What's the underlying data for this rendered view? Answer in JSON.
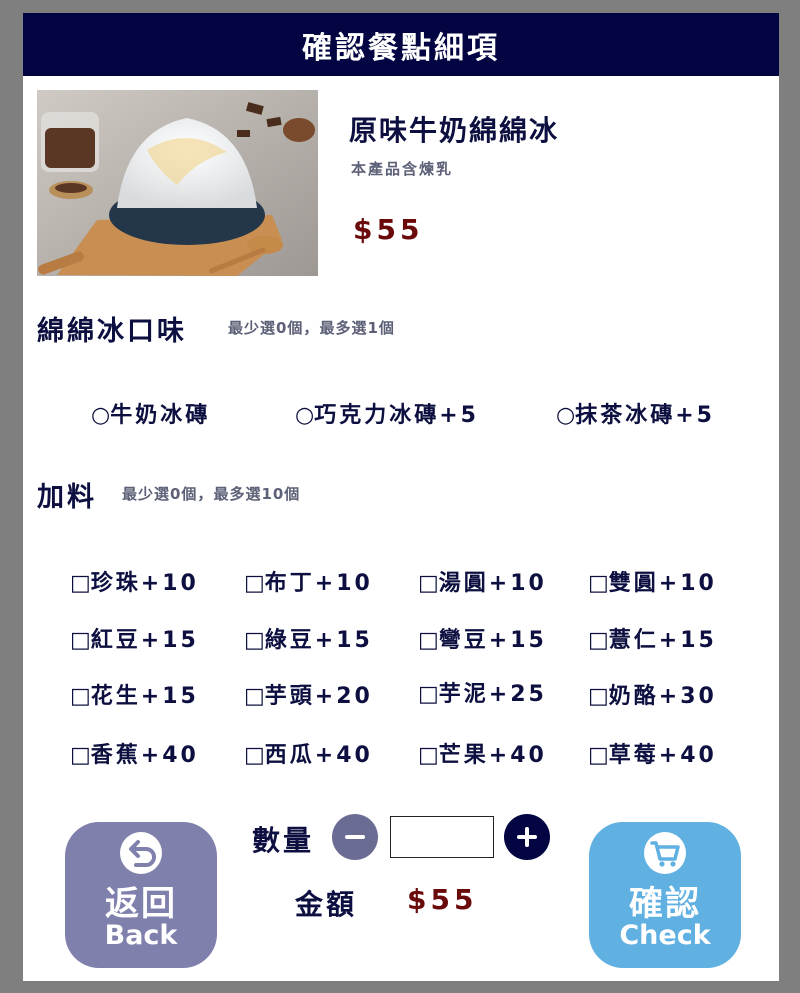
{
  "header": {
    "title": "確認餐點細項"
  },
  "product": {
    "image_alt": "原味牛奶綿綿冰",
    "name": "原味牛奶綿綿冰",
    "note": "本產品含煉乳",
    "price": "$55"
  },
  "flavor_section": {
    "title": "綿綿冰口味",
    "hint": "最少選0個，最多選1個",
    "options": [
      {
        "mark": "○",
        "label": "牛奶冰磚"
      },
      {
        "mark": "○",
        "label": "巧克力冰磚+5"
      },
      {
        "mark": "○",
        "label": "抹茶冰磚+5"
      }
    ]
  },
  "topping_section": {
    "title": "加料",
    "hint": "最少選0個，最多選10個",
    "options": [
      {
        "mark": "□",
        "label": "珍珠+10"
      },
      {
        "mark": "□",
        "label": "布丁+10"
      },
      {
        "mark": "□",
        "label": "湯圓+10"
      },
      {
        "mark": "□",
        "label": "雙圓+10"
      },
      {
        "mark": "□",
        "label": "紅豆+15"
      },
      {
        "mark": "□",
        "label": "綠豆+15"
      },
      {
        "mark": "□",
        "label": "彎豆+15"
      },
      {
        "mark": "□",
        "label": "薏仁+15"
      },
      {
        "mark": "□",
        "label": "花生+15"
      },
      {
        "mark": "□",
        "label": "芋頭+20"
      },
      {
        "mark": "□",
        "label": "芋泥+25"
      },
      {
        "mark": "□",
        "label": "奶酪+30"
      },
      {
        "mark": "□",
        "label": "香蕉+40"
      },
      {
        "mark": "□",
        "label": "西瓜+40"
      },
      {
        "mark": "□",
        "label": "芒果+40"
      },
      {
        "mark": "□",
        "label": "草莓+40"
      }
    ]
  },
  "order": {
    "quantity_label": "數量",
    "quantity_value": "",
    "minus_icon": "minus-icon",
    "plus_icon": "plus-icon",
    "amount_label": "金額",
    "amount_value": "$55"
  },
  "buttons": {
    "back": {
      "icon": "undo-arrow-icon",
      "label_zh": "返回",
      "label_en": "Back"
    },
    "check": {
      "icon": "shopping-cart-icon",
      "label_zh": "確認",
      "label_en": "Check"
    }
  },
  "colors": {
    "header_bg": "#020542",
    "page_bg": "#7f7f7f",
    "price": "#6a0a0a",
    "back_button": "#8080ad",
    "check_button": "#60b0e2",
    "minus_button": "#6b6c93",
    "plus_button": "#020542"
  }
}
